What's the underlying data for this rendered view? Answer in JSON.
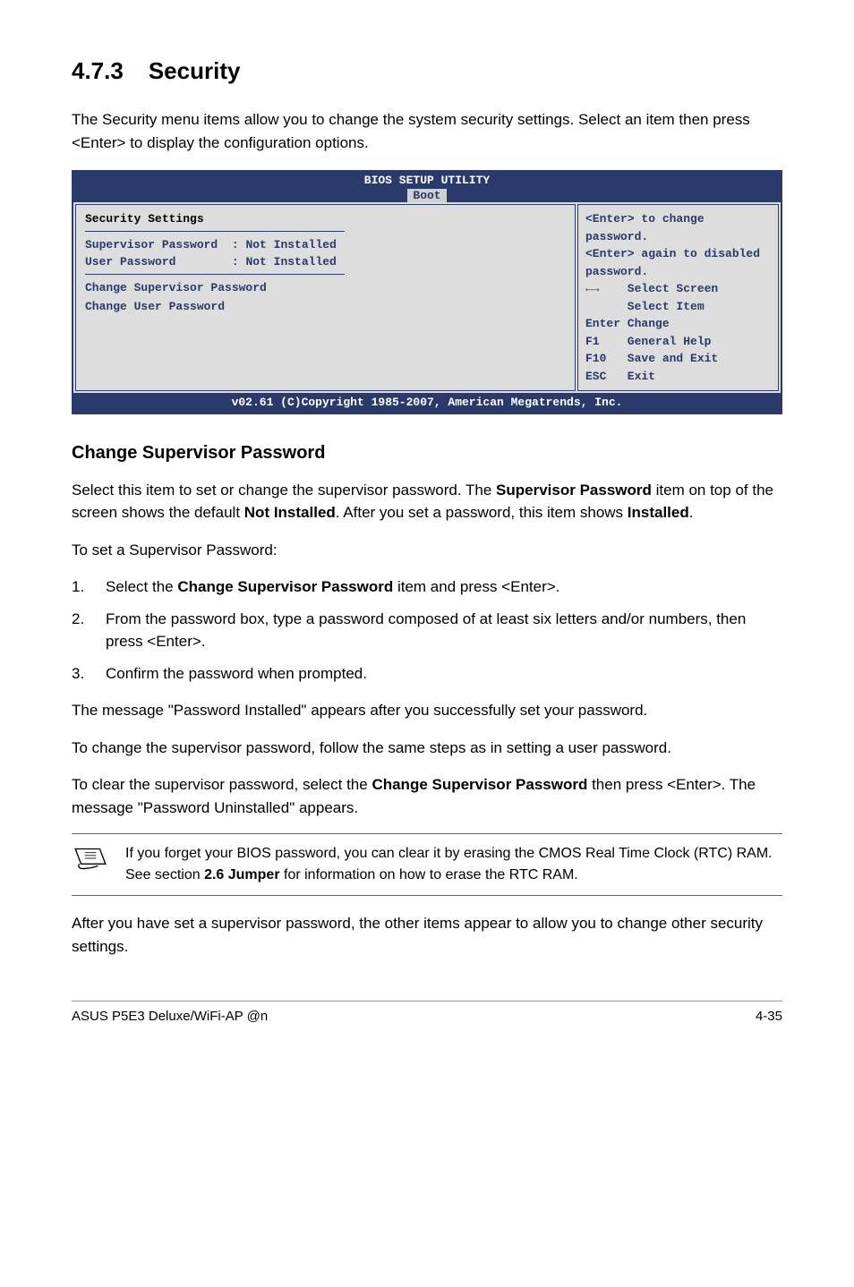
{
  "heading": {
    "number": "4.7.3",
    "title": "Security"
  },
  "intro": "The Security menu items allow you to change the system security settings. Select an item then press <Enter> to display the configuration options.",
  "bios": {
    "title": "BIOS SETUP UTILITY",
    "tab": "Boot",
    "sec_title": "Security Settings",
    "sup_label": "Supervisor Password",
    "sup_value": ": Not Installed",
    "user_label": "User Password",
    "user_value": ": Not Installed",
    "menu1": "Change Supervisor Password",
    "menu2": "Change User Password",
    "help1": "<Enter> to change password.",
    "help2": "<Enter> again to disabled password.",
    "legend": "      Select Screen\n      Select Item\nEnter Change\nF1    General Help\nF10   Save and Exit\nESC   Exit",
    "arrows_lr": "←→",
    "arrows_ud": "↑↓",
    "footer": "v02.61 (C)Copyright 1985-2007, American Megatrends, Inc."
  },
  "sub_heading": "Change Supervisor Password",
  "p1_a": "Select this item to set or change the supervisor password. The ",
  "p1_b": "Supervisor Password",
  "p1_c": " item on top of the screen shows the default ",
  "p1_d": "Not Installed",
  "p1_e": ". After you set a password, this item shows ",
  "p1_f": "Installed",
  "p1_g": ".",
  "p2": "To set a Supervisor Password:",
  "steps": {
    "s1_num": "1.",
    "s1_a": "Select the ",
    "s1_b": "Change Supervisor Password",
    "s1_c": " item and press <Enter>.",
    "s2_num": "2.",
    "s2": "From the password box, type a password composed of at least six letters and/or numbers, then press <Enter>.",
    "s3_num": "3.",
    "s3": "Confirm the password when prompted."
  },
  "p3": "The message \"Password Installed\" appears after you successfully set your password.",
  "p4": "To change the supervisor password, follow the same steps as in setting a user password.",
  "p5_a": "To clear the supervisor password, select the ",
  "p5_b": "Change Supervisor Password",
  "p5_c": " then press <Enter>. The message \"Password Uninstalled\" appears.",
  "note_a": "If you forget your BIOS password, you can clear it by erasing the CMOS Real Time Clock (RTC) RAM. See section ",
  "note_b": "2.6 Jumper",
  "note_c": " for information on how to erase the RTC RAM.",
  "p6": "After you have set a supervisor password, the other items appear to allow you to change other security settings.",
  "footer": {
    "left": "ASUS P5E3 Deluxe/WiFi-AP @n",
    "right": "4-35"
  }
}
